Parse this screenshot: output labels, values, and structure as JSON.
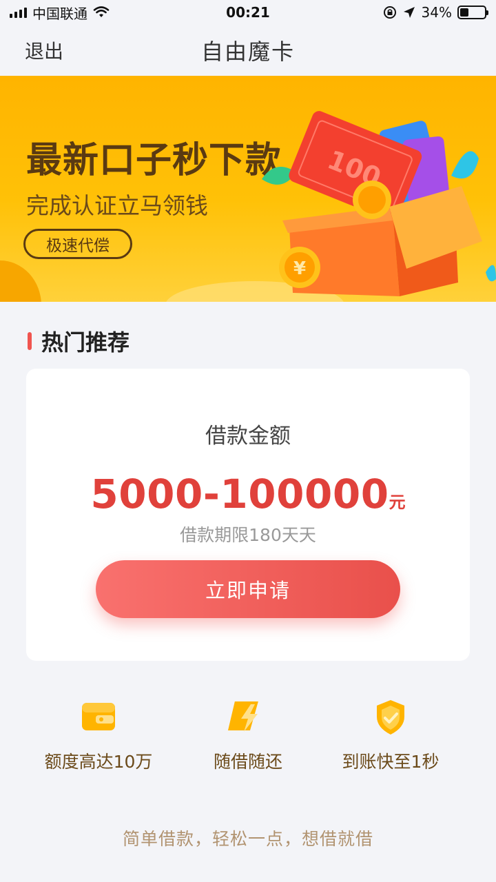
{
  "status_bar": {
    "carrier": "中国联通",
    "time": "00:21",
    "battery_text": "34%",
    "battery_level": 0.34
  },
  "nav": {
    "back_label": "退出",
    "title": "自由魔卡"
  },
  "banner": {
    "title": "最新口子秒下款",
    "subtitle": "完成认证立马领钱",
    "button_label": "极速代偿",
    "ticket_text": "100",
    "coin_text": "¥"
  },
  "section": {
    "title": "热门推荐"
  },
  "loan_card": {
    "label": "借款金额",
    "amount": "5000-100000",
    "unit": "元",
    "term": "借款期限180天天",
    "apply_label": "立即申请"
  },
  "features": [
    {
      "icon": "wallet-icon",
      "label": "额度高达10万"
    },
    {
      "icon": "lightning-icon",
      "label": "随借随还"
    },
    {
      "icon": "shield-icon",
      "label": "到账快至1秒"
    }
  ],
  "footer": {
    "slogan": "简单借款，轻松一点，想借就借"
  },
  "colors": {
    "accent": "#f0544f",
    "amount": "#e0413b",
    "banner_bg": "#ffb400",
    "brown_text": "#6b4a1a"
  }
}
